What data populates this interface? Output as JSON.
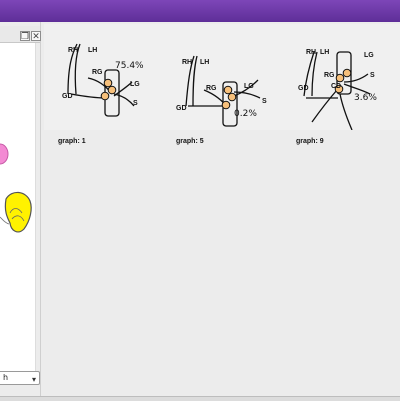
{
  "window": {
    "accent": "#6b35a8"
  },
  "left_panel": {
    "header_buttons": [
      "restore-icon",
      "close-icon"
    ],
    "dropdown": {
      "value": "h",
      "arrow_icon": "chevron-down-icon"
    }
  },
  "gallery": {
    "items": [
      {
        "caption": "graph: 1",
        "percent": "75.4%",
        "labels": {
          "rh": "RH",
          "lh": "LH",
          "rg": "RG",
          "lg": "LG",
          "gd": "GD",
          "s": "S"
        }
      },
      {
        "caption": "graph: 5",
        "percent": "0.2%",
        "labels": {
          "rh": "RH",
          "lh": "LH",
          "rg": "RG",
          "lg": "LG",
          "gd": "GD",
          "s": "S"
        }
      },
      {
        "caption": "graph: 9",
        "percent": "3.6%",
        "labels": {
          "rh": "RH",
          "lh": "LH",
          "rg": "RG",
          "lg": "LG",
          "gd": "GD",
          "s": "S",
          "cd": "CD"
        }
      }
    ]
  }
}
